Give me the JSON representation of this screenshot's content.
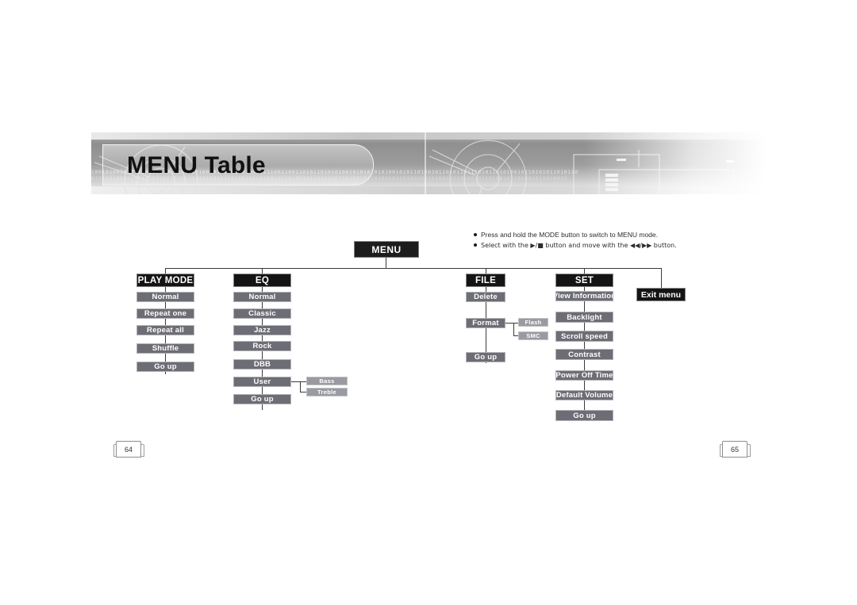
{
  "document": {
    "title": "MENU Table",
    "page_left": "64",
    "page_right": "65"
  },
  "notes": [
    "Press and hold the MODE button to switch to MENU mode.",
    "Select with the ▶/■ button and move with the ◀◀/▶▶ button."
  ],
  "tree": {
    "root_label": "MENU",
    "exit_label": "Exit menu",
    "columns": [
      {
        "header": "PLAY MODE",
        "items": [
          "Normal",
          "Repeat one",
          "Repeat all",
          "Shuffle",
          "Go up"
        ]
      },
      {
        "header": "EQ",
        "items": [
          "Normal",
          "Classic",
          "Jazz",
          "Rock",
          "DBB",
          "User",
          "Go up"
        ],
        "sub_items": [
          "Bass",
          "Treble"
        ]
      },
      {
        "header": "FILE",
        "items": [
          "Delete",
          "Format",
          "Go up"
        ],
        "sub_items": [
          "Flash",
          "SMC"
        ]
      },
      {
        "header": "SET",
        "items": [
          "View Information",
          "Backlight",
          "Scroll speed",
          "Contrast",
          "Power Off Time",
          "Default Volume",
          "Go up"
        ]
      }
    ]
  },
  "colors": {
    "header_box": "#141414",
    "item_box": "#6d6d75",
    "sub_box": "#9a9aa2",
    "line": "#3a3a3a",
    "text_on_box": "#ffffff"
  },
  "banner": {
    "binary_strip_a": "1001010010111010110110101010101001011010100100101110011001101011010101001010101010100101011010010110101101110101101010010110101011010110",
    "binary_strip_b": "0101101001010110100101101001011010010110100101101001011010010110100101101001011010010110100101101001011010010110100101101001011010010"
  }
}
